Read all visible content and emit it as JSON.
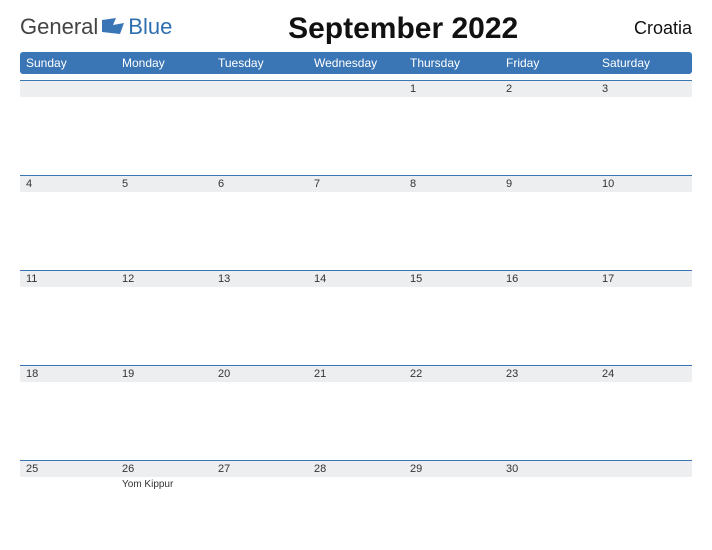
{
  "header": {
    "logo_text_a": "General",
    "logo_text_b": "Blue",
    "title": "September 2022",
    "region": "Croatia"
  },
  "day_headers": [
    "Sunday",
    "Monday",
    "Tuesday",
    "Wednesday",
    "Thursday",
    "Friday",
    "Saturday"
  ],
  "weeks": [
    {
      "dates": [
        "",
        "",
        "",
        "",
        "1",
        "2",
        "3"
      ],
      "events": [
        "",
        "",
        "",
        "",
        "",
        "",
        ""
      ]
    },
    {
      "dates": [
        "4",
        "5",
        "6",
        "7",
        "8",
        "9",
        "10"
      ],
      "events": [
        "",
        "",
        "",
        "",
        "",
        "",
        ""
      ]
    },
    {
      "dates": [
        "11",
        "12",
        "13",
        "14",
        "15",
        "16",
        "17"
      ],
      "events": [
        "",
        "",
        "",
        "",
        "",
        "",
        ""
      ]
    },
    {
      "dates": [
        "18",
        "19",
        "20",
        "21",
        "22",
        "23",
        "24"
      ],
      "events": [
        "",
        "",
        "",
        "",
        "",
        "",
        ""
      ]
    },
    {
      "dates": [
        "25",
        "26",
        "27",
        "28",
        "29",
        "30",
        ""
      ],
      "events": [
        "",
        "Yom Kippur",
        "",
        "",
        "",
        "",
        ""
      ]
    }
  ]
}
